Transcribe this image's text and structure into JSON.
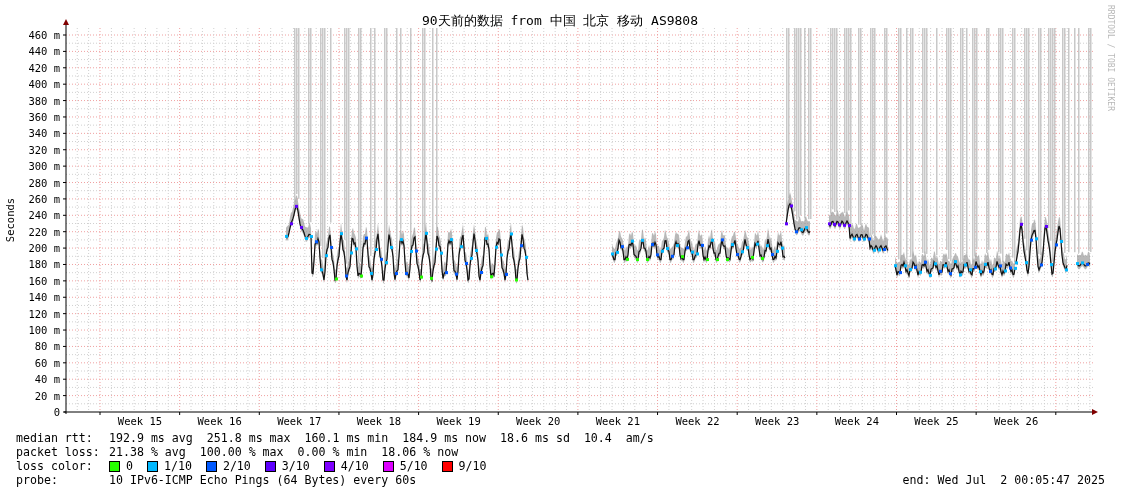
{
  "title": "90天前的数据 from 中国 北京 移动 AS9808",
  "credit": "RRDTOOL / TOBI OETIKER",
  "y_axis": {
    "label": "Seconds",
    "ticks": [
      "460 m",
      "440 m",
      "420 m",
      "400 m",
      "380 m",
      "360 m",
      "340 m",
      "320 m",
      "300 m",
      "280 m",
      "260 m",
      "240 m",
      "220 m",
      "200 m",
      "180 m",
      "160 m",
      "140 m",
      "120 m",
      "100 m",
      "80 m",
      "60 m",
      "40 m",
      "20 m",
      "0"
    ]
  },
  "x_axis": {
    "ticks": [
      "Week 15",
      "Week 16",
      "Week 17",
      "Week 18",
      "Week 19",
      "Week 20",
      "Week 21",
      "Week 22",
      "Week 23",
      "Week 24",
      "Week 25",
      "Week 26"
    ]
  },
  "median_rtt": {
    "label": "median rtt:",
    "values": [
      "192.9 ms avg",
      "251.8 ms max",
      "160.1 ms min",
      "184.9 ms now",
      "18.6 ms sd",
      "10.4",
      "am/s"
    ]
  },
  "packet_loss": {
    "label": "packet loss:",
    "values": [
      "21.38 % avg",
      "100.00 % max",
      "0.00 % min",
      "18.06 % now"
    ]
  },
  "loss_color": {
    "label": "loss color:",
    "items": [
      {
        "label": "0",
        "color": "#26ff00"
      },
      {
        "label": "1/10",
        "color": "#00b8ff"
      },
      {
        "label": "2/10",
        "color": "#0059ff"
      },
      {
        "label": "3/10",
        "color": "#5e00ff"
      },
      {
        "label": "4/10",
        "color": "#7e00ff"
      },
      {
        "label": "5/10",
        "color": "#dd00ff"
      },
      {
        "label": "9/10",
        "color": "#ff0000"
      }
    ]
  },
  "probe": {
    "label": "probe:",
    "value": "10 IPv6-ICMP Echo Pings (64 Bytes) every 60s"
  },
  "end": "end: Wed Jul  2 00:05:47 2025"
}
